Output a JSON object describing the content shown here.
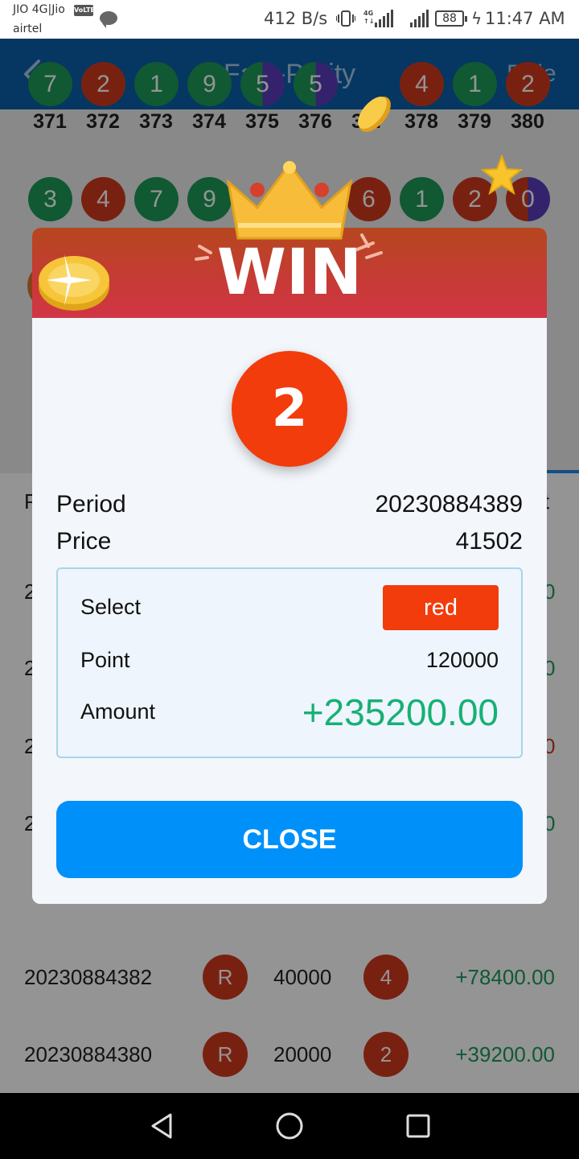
{
  "status_bar": {
    "carrier_line1": "JIO 4G|Jio",
    "volte": "VoLTE",
    "carrier_line2": "airtel",
    "net_speed": "412 B/s",
    "lte_tag_top": "4G",
    "lte_tag_bottom": "↑↓",
    "battery": "88",
    "time": "11:47 AM"
  },
  "header": {
    "title": "Fast-Parity",
    "rule": "Rule",
    "back_icon": "chevron-left-icon"
  },
  "history": {
    "row1": {
      "balls": [
        {
          "n": "7",
          "c": "green"
        },
        {
          "n": "2",
          "c": "red"
        },
        {
          "n": "1",
          "c": "green"
        },
        {
          "n": "9",
          "c": "green"
        },
        {
          "n": "5",
          "c": "green-violet"
        },
        {
          "n": "5",
          "c": "green-violet"
        },
        {
          "n": "",
          "c": "hidden"
        },
        {
          "n": "4",
          "c": "red"
        },
        {
          "n": "1",
          "c": "green"
        },
        {
          "n": "2",
          "c": "red"
        }
      ],
      "periods": [
        "371",
        "372",
        "373",
        "374",
        "375",
        "376",
        "377",
        "378",
        "379",
        "380"
      ]
    },
    "row2": {
      "balls": [
        {
          "n": "3",
          "c": "green"
        },
        {
          "n": "4",
          "c": "red"
        },
        {
          "n": "7",
          "c": "green"
        },
        {
          "n": "9",
          "c": "green"
        },
        {
          "n": "",
          "c": "hidden"
        },
        {
          "n": "",
          "c": "hidden"
        },
        {
          "n": "6",
          "c": "red"
        },
        {
          "n": "1",
          "c": "green"
        },
        {
          "n": "2",
          "c": "red"
        },
        {
          "n": "0",
          "c": "red-violet"
        }
      ]
    }
  },
  "records": {
    "col_period_partial": "P",
    "col_result_partial": "t",
    "edge_left": "2",
    "edge_right": [
      "0",
      "0",
      "0",
      "0"
    ],
    "rows": [
      {
        "period": "20230884382",
        "select": "R",
        "point": "40000",
        "result": "4",
        "amount": "+78400.00"
      },
      {
        "period": "20230884380",
        "select": "R",
        "point": "20000",
        "result": "2",
        "amount": "+39200.00"
      }
    ]
  },
  "dialog": {
    "title": "WIN",
    "result_number": "2",
    "period_label": "Period",
    "period_value": "20230884389",
    "price_label": "Price",
    "price_value": "41502",
    "select_label": "Select",
    "select_value": "red",
    "point_label": "Point",
    "point_value": "120000",
    "amount_label": "Amount",
    "amount_value": "+235200.00",
    "close_label": "CLOSE"
  },
  "colors": {
    "header_bg": "#0a5faa",
    "green": "#1c9a57",
    "red": "#d03a1e",
    "violet": "#5b3dbb",
    "result_ball": "#f23c0c",
    "amount_green": "#17b075",
    "close_button": "#0090fa"
  },
  "nav": {
    "back_icon": "triangle-back-icon",
    "home_icon": "circle-home-icon",
    "recent_icon": "square-recents-icon"
  }
}
